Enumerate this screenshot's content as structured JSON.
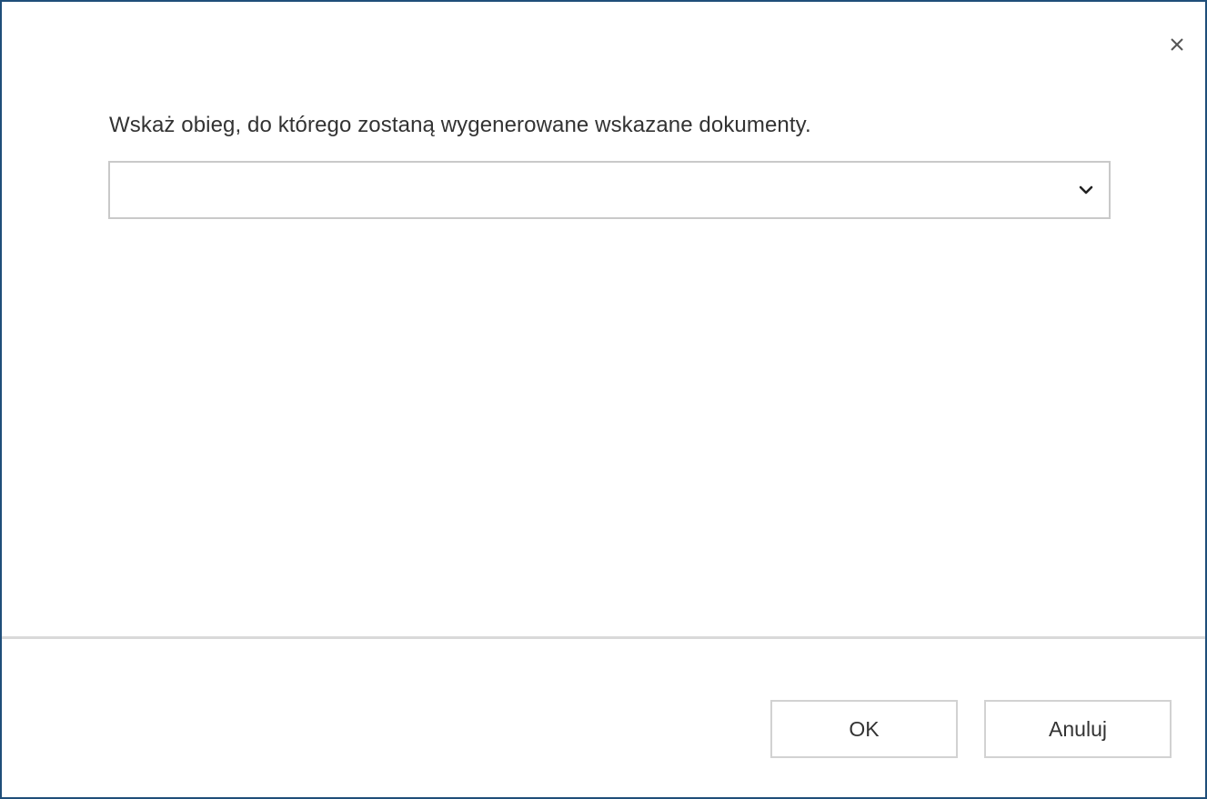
{
  "dialog": {
    "prompt": "Wskaż obieg, do którego zostaną wygenerowane wskazane dokumenty.",
    "select": {
      "value": "",
      "icon": "chevron-down-icon"
    },
    "close_icon": "close-icon",
    "buttons": {
      "ok_label": "OK",
      "cancel_label": "Anuluj"
    }
  },
  "colors": {
    "window_border": "#1f4e79",
    "field_border": "#c9c9c9",
    "divider": "#d9d9d9",
    "text": "#333333"
  }
}
